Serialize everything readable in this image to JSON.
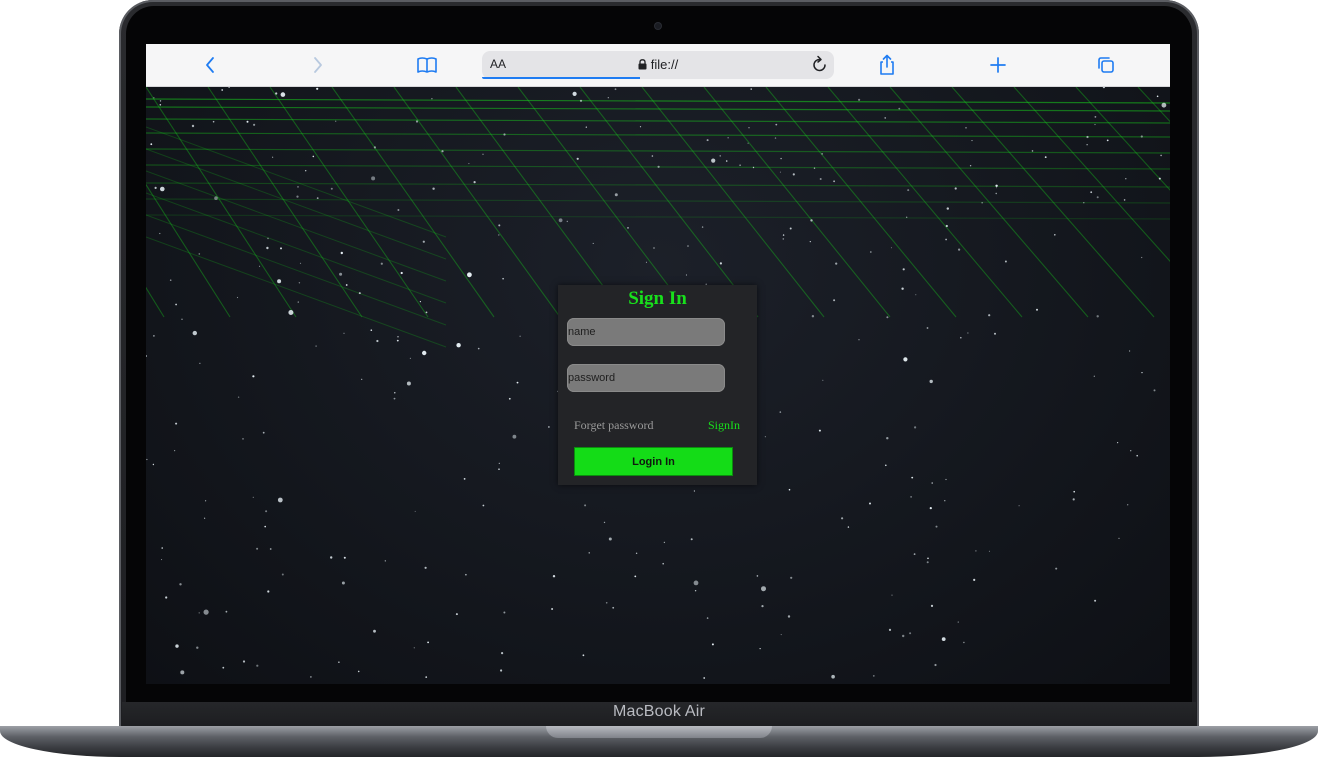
{
  "device": {
    "label": "MacBook Air"
  },
  "browser": {
    "address_aa": "AA",
    "url": "file://",
    "load_progress": 0.45,
    "icons": {
      "back": "chevron-left-icon",
      "forward": "chevron-right-icon",
      "bookmarks": "book-icon",
      "lock": "lock-icon",
      "reload": "reload-icon",
      "share": "share-icon",
      "new_tab": "plus-icon",
      "tabs": "tabs-icon"
    },
    "accent_color": "#1f7cf2"
  },
  "login": {
    "title": "Sign In",
    "name_placeholder": "name",
    "password_placeholder": "password",
    "forget_label": "Forget password",
    "signin_link": "SignIn",
    "button_label": "Login In",
    "accent_color": "#18e01c"
  }
}
